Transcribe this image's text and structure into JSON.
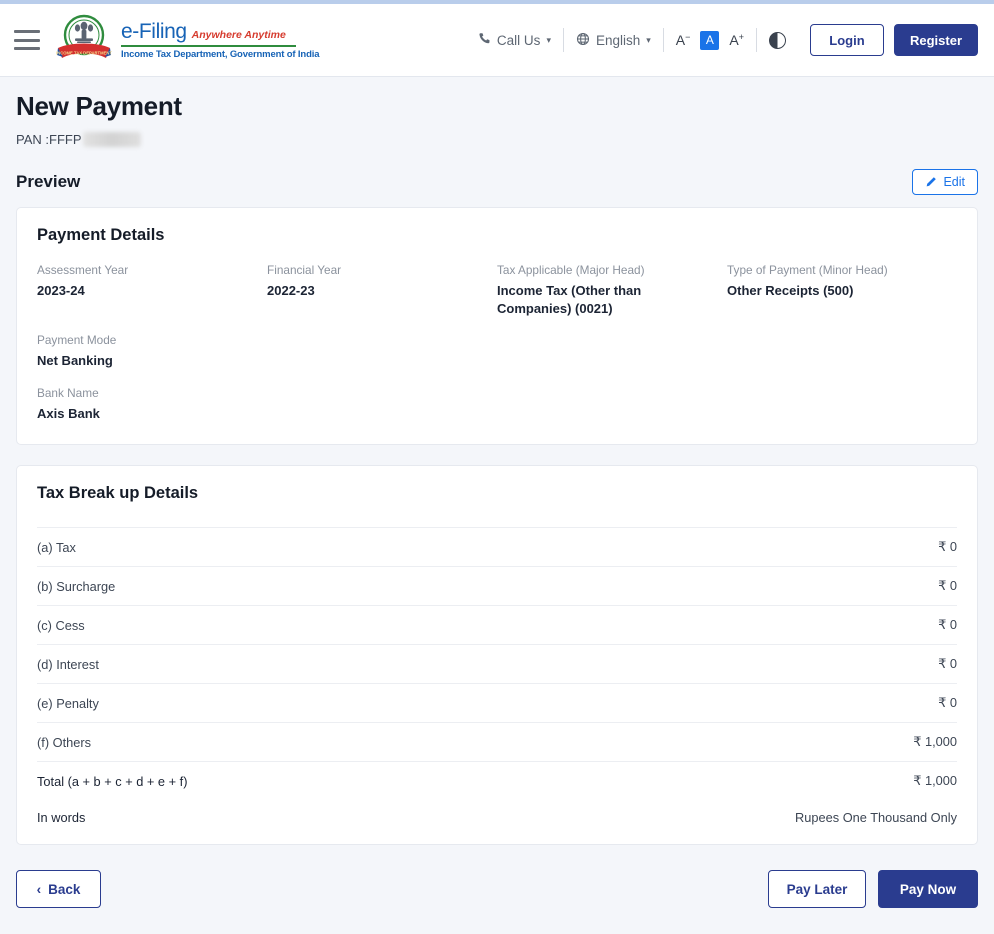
{
  "top_strip": {
    "color": "#b9cdeb"
  },
  "header": {
    "menu_icon": "hamburger-icon",
    "logo": {
      "emblem_alt": "india-national-emblem",
      "title": "e-Filing",
      "tagline": "Anywhere Anytime",
      "department": "Income Tax Department, Government of India"
    },
    "call_us": {
      "label": "Call Us",
      "icon": "phone-icon",
      "chevron": "⌄"
    },
    "language": {
      "label": "English",
      "icon": "globe-icon",
      "chevron": "⌄"
    },
    "font_controls": {
      "decrease": "A",
      "decrease_sup": "−",
      "normal": "A",
      "increase": "A",
      "increase_sup": "+"
    },
    "contrast": {
      "icon": "contrast-icon"
    },
    "login_label": "Login",
    "register_label": "Register",
    "colors": {
      "brand_navy": "#2a3c8f",
      "link_blue": "#1a73e8",
      "brand_green": "#2f8c3e",
      "brand_red": "#d63c2f"
    }
  },
  "page": {
    "title": "New Payment",
    "pan_label": "PAN : ",
    "pan_value": "FFFP",
    "pan_masked": true,
    "preview_label": "Preview",
    "edit_label": "Edit",
    "edit_icon": "pencil-icon"
  },
  "payment_details": {
    "title": "Payment Details",
    "fields": [
      {
        "label": "Assessment Year",
        "value": "2023-24"
      },
      {
        "label": "Financial Year",
        "value": "2022-23"
      },
      {
        "label": "Tax Applicable (Major Head)",
        "value": "Income Tax (Other than Companies) (0021)"
      },
      {
        "label": "Type of Payment (Minor Head)",
        "value": "Other Receipts (500)"
      },
      {
        "label": "Payment Mode",
        "value": "Net Banking"
      },
      {
        "label": "Bank Name",
        "value": "Axis Bank"
      }
    ]
  },
  "tax_breakup": {
    "title": "Tax Break up Details",
    "rows": [
      {
        "label": "(a) Tax",
        "amount": "₹ 0"
      },
      {
        "label": "(b) Surcharge",
        "amount": "₹ 0"
      },
      {
        "label": "(c) Cess",
        "amount": "₹ 0"
      },
      {
        "label": "(d) Interest",
        "amount": "₹ 0"
      },
      {
        "label": "(e) Penalty",
        "amount": "₹ 0"
      },
      {
        "label": "(f) Others",
        "amount": "₹ 1,000"
      }
    ],
    "total": {
      "label": "Total (a + b + c + d + e + f)",
      "amount": "₹ 1,000"
    },
    "in_words": {
      "label": "In words",
      "value": "Rupees One Thousand Only"
    }
  },
  "actions": {
    "back_label": "Back",
    "back_icon": "chevron-left-icon",
    "pay_later_label": "Pay Later",
    "pay_now_label": "Pay Now"
  }
}
